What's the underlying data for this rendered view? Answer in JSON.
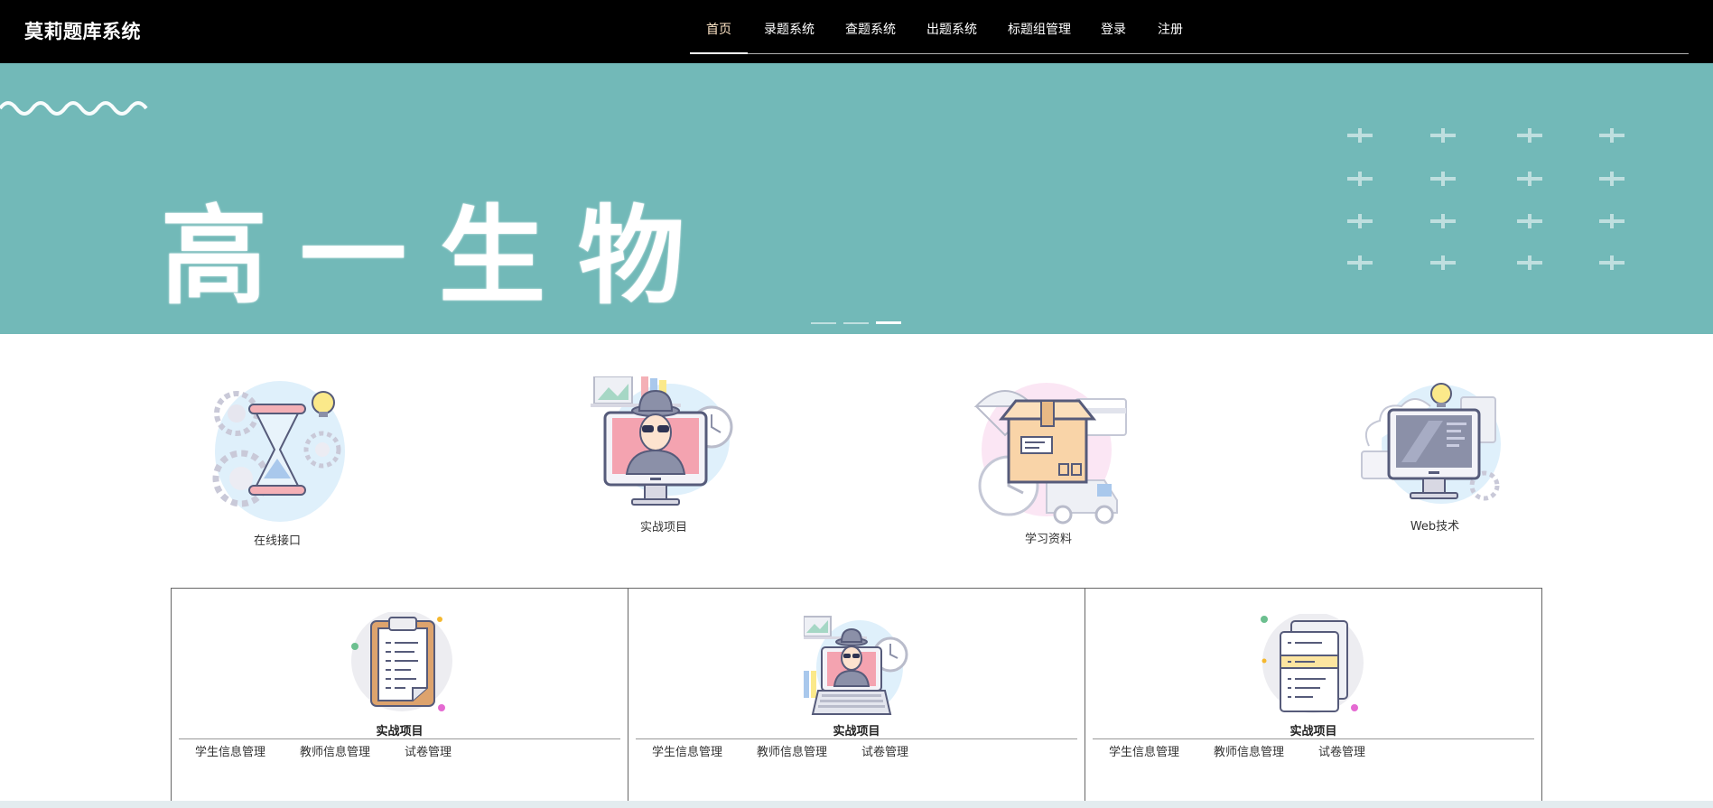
{
  "brand": "莫莉题库系统",
  "nav": {
    "items": [
      "首页",
      "录题系统",
      "查题系统",
      "出题系统",
      "标题组管理",
      "登录",
      "注册"
    ],
    "active_index": 0
  },
  "banner": {
    "title": "高一生物",
    "background_color": "#72b9b8",
    "slides_count": 3,
    "active_slide": 3
  },
  "features": [
    {
      "label": "在线接口",
      "icon": "hourglass-gears-icon"
    },
    {
      "label": "实战项目",
      "icon": "spy-monitor-icon"
    },
    {
      "label": "学习资料",
      "icon": "parcel-box-icon"
    },
    {
      "label": "Web技术",
      "icon": "web-monitor-icon"
    }
  ],
  "cards": [
    {
      "title": "实战项目",
      "icon": "clipboard-icon",
      "links": [
        "学生信息管理",
        "教师信息管理",
        "试卷管理"
      ]
    },
    {
      "title": "实战项目",
      "icon": "spy-laptop-icon",
      "links": [
        "学生信息管理",
        "教师信息管理",
        "试卷管理"
      ]
    },
    {
      "title": "实战项目",
      "icon": "documents-icon",
      "links": [
        "学生信息管理",
        "教师信息管理",
        "试卷管理"
      ]
    }
  ]
}
